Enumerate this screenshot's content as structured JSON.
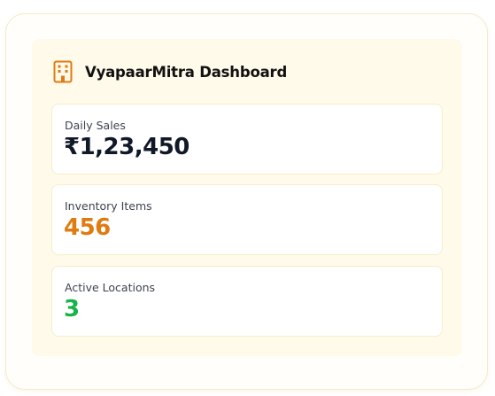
{
  "app": {
    "title": "VyapaarMitra Dashboard",
    "icon": "building-icon",
    "accent_color": "#e07b12"
  },
  "stats": [
    {
      "label": "Daily Sales",
      "value": "₹1,23,450",
      "color": "#111827"
    },
    {
      "label": "Inventory Items",
      "value": "456",
      "color": "#e07b12"
    },
    {
      "label": "Active Locations",
      "value": "3",
      "color": "#16b34a"
    }
  ]
}
